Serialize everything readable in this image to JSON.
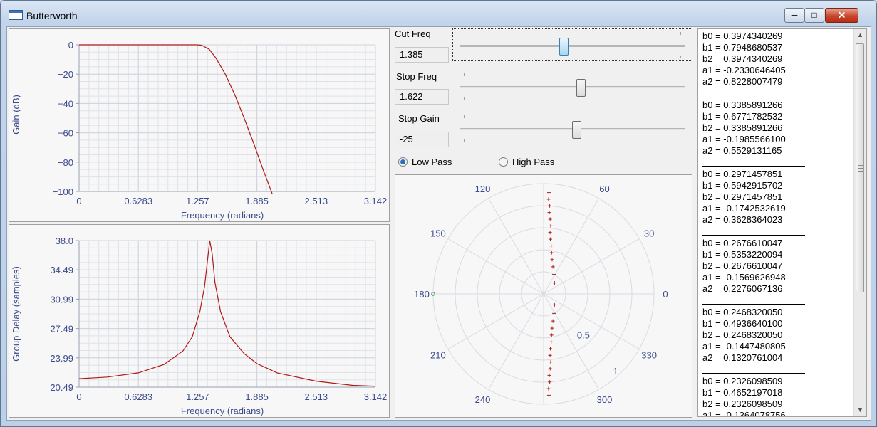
{
  "window": {
    "title": "Butterworth"
  },
  "gain_chart": {
    "ylabel": "Gain (dB)",
    "xlabel": "Frequency (radians)",
    "y_ticks": [
      "0",
      "−20",
      "−40",
      "−60",
      "−80",
      "−100"
    ],
    "x_ticks": [
      "0",
      "0.6283",
      "1.257",
      "1.885",
      "2.513",
      "3.142"
    ]
  },
  "delay_chart": {
    "ylabel": "Group Delay (samples)",
    "xlabel": "Frequency (radians)",
    "y_ticks": [
      "38.0",
      "34.49",
      "30.99",
      "27.49",
      "23.99",
      "20.49"
    ],
    "x_ticks": [
      "0",
      "0.6283",
      "1.257",
      "1.885",
      "2.513",
      "3.142"
    ]
  },
  "chart_data": [
    {
      "type": "line",
      "xlabel": "Frequency (radians)",
      "ylabel": "Gain (dB)",
      "xlim": [
        0,
        3.142
      ],
      "ylim": [
        -100,
        0
      ],
      "grid": true,
      "series": [
        {
          "x": [
            0,
            0.6283,
            1.0,
            1.2,
            1.257,
            1.3,
            1.38,
            1.45,
            1.55,
            1.65,
            1.75,
            1.85,
            1.95,
            2.05
          ],
          "y": [
            0,
            0,
            0,
            0,
            0,
            -0.3,
            -3,
            -9,
            -20,
            -34,
            -50,
            -67,
            -85,
            -102
          ]
        }
      ]
    },
    {
      "type": "line",
      "xlabel": "Frequency (radians)",
      "ylabel": "Group Delay (samples)",
      "xlim": [
        0,
        3.142
      ],
      "ylim": [
        20.49,
        38.0
      ],
      "grid": true,
      "series": [
        {
          "x": [
            0,
            0.3,
            0.6283,
            0.9,
            1.1,
            1.2,
            1.28,
            1.33,
            1.36,
            1.385,
            1.41,
            1.44,
            1.5,
            1.6,
            1.75,
            1.885,
            2.1,
            2.513,
            2.9,
            3.142
          ],
          "y": [
            21.5,
            21.7,
            22.2,
            23.2,
            24.8,
            26.5,
            29.5,
            32.5,
            35.5,
            38.0,
            36.5,
            33.0,
            29.5,
            26.5,
            24.5,
            23.3,
            22.2,
            21.2,
            20.7,
            20.6
          ]
        }
      ]
    },
    {
      "type": "scatter",
      "coordinate_system": "polar",
      "angle_ticks": [
        "0",
        "30",
        "60",
        "120",
        "150",
        "180",
        "210",
        "240",
        "300",
        "330"
      ],
      "radius_ticks": [
        "0.5",
        "1"
      ],
      "series": [
        {
          "name": "poles",
          "marker": "+",
          "points": [
            [
              0.92,
              87
            ],
            [
              0.86,
              87
            ],
            [
              0.8,
              86
            ],
            [
              0.74,
              86
            ],
            [
              0.68,
              85
            ],
            [
              0.62,
              84
            ],
            [
              0.56,
              84
            ],
            [
              0.5,
              83
            ],
            [
              0.44,
              81
            ],
            [
              0.38,
              79
            ],
            [
              0.32,
              76
            ],
            [
              0.26,
              71
            ],
            [
              0.2,
              62
            ],
            [
              0.14,
              45
            ],
            [
              0.92,
              -87
            ],
            [
              0.86,
              -87
            ],
            [
              0.8,
              -86
            ],
            [
              0.74,
              -86
            ],
            [
              0.68,
              -85
            ],
            [
              0.62,
              -84
            ],
            [
              0.56,
              -84
            ],
            [
              0.5,
              -83
            ],
            [
              0.44,
              -81
            ],
            [
              0.38,
              -79
            ],
            [
              0.32,
              -76
            ],
            [
              0.26,
              -71
            ],
            [
              0.2,
              -62
            ],
            [
              0.14,
              -45
            ]
          ]
        },
        {
          "name": "zeros",
          "marker": "o",
          "points": [
            [
              1.0,
              180
            ]
          ]
        }
      ]
    }
  ],
  "polar_chart": {
    "angle_labels": [
      "0",
      "30",
      "60",
      "120",
      "150",
      "180",
      "210",
      "240",
      "300",
      "330"
    ],
    "radius_labels": [
      "0.5",
      "1"
    ]
  },
  "controls": {
    "cut_freq": {
      "label": "Cut Freq",
      "value": "1.385",
      "slider_fraction": 0.46
    },
    "stop_freq": {
      "label": "Stop Freq",
      "value": "1.622",
      "slider_fraction": 0.54
    },
    "stop_gain": {
      "label": "Stop Gain",
      "value": "-25",
      "slider_fraction": 0.52
    },
    "low_pass": {
      "label": "Low Pass",
      "selected": true
    },
    "high_pass": {
      "label": "High Pass",
      "selected": false
    }
  },
  "coefficients": [
    [
      "b0 = 0.3974340269",
      "b1 = 0.7948680537",
      "b2 = 0.3974340269",
      "a1 = -0.2330646405",
      "a2 = 0.8228007479"
    ],
    [
      "b0 = 0.3385891266",
      "b1 = 0.6771782532",
      "b2 = 0.3385891266",
      "a1 = -0.1985566100",
      "a2 = 0.5529131165"
    ],
    [
      "b0 = 0.2971457851",
      "b1 = 0.5942915702",
      "b2 = 0.2971457851",
      "a1 = -0.1742532619",
      "a2 = 0.3628364023"
    ],
    [
      "b0 = 0.2676610047",
      "b1 = 0.5353220094",
      "b2 = 0.2676610047",
      "a1 = -0.1569626948",
      "a2 = 0.2276067136"
    ],
    [
      "b0 = 0.2468320050",
      "b1 = 0.4936640100",
      "b2 = 0.2468320050",
      "a1 = -0.1447480805",
      "a2 = 0.1320761004"
    ],
    [
      "b0 = 0.2326098509",
      "b1 = 0.4652197018",
      "b2 = 0.2326098509",
      "a1 = -0.1364078756"
    ]
  ]
}
